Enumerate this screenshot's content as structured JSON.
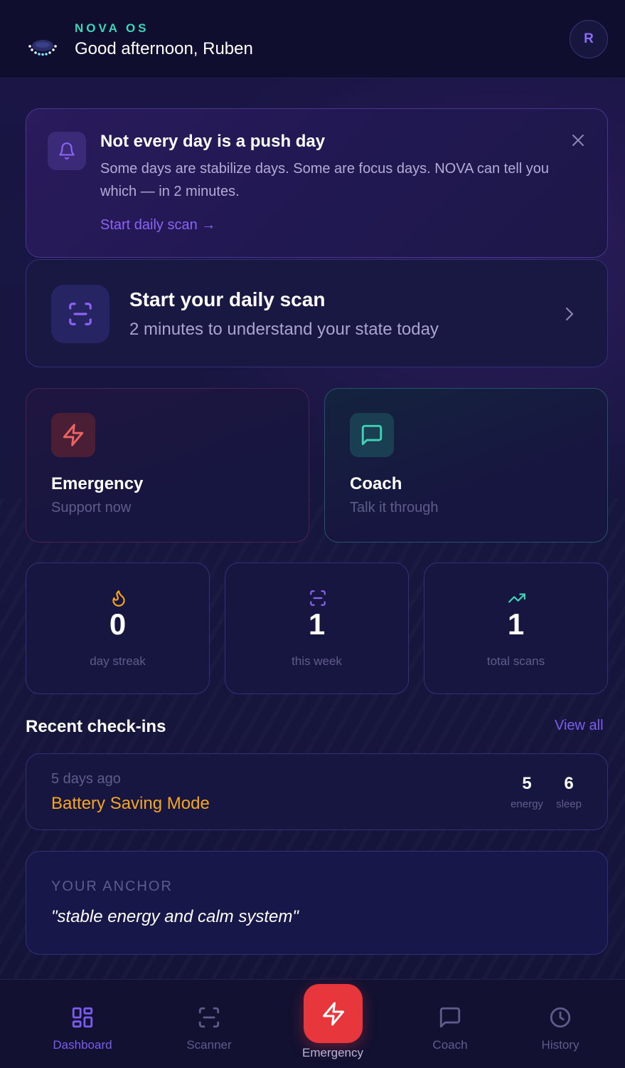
{
  "header": {
    "brand": "NOVA OS",
    "greeting": "Good afternoon, Ruben",
    "avatar_initial": "R",
    "logo_icon": "nova-orb-icon"
  },
  "notice": {
    "icon": "bell-icon",
    "title": "Not every day is a push day",
    "body": "Some days are stabilize days. Some are focus days. NOVA can tell you which — in 2 minutes.",
    "link": "Start daily scan →",
    "close_icon": "close-icon"
  },
  "scan_card": {
    "icon": "scan-icon",
    "title": "Start your daily scan",
    "subtitle": "2 minutes to understand your state today"
  },
  "actions": {
    "emergency": {
      "title": "Emergency",
      "subtitle": "Support now",
      "icon": "lightning-icon",
      "color": "#f06363"
    },
    "coach": {
      "title": "Coach",
      "subtitle": "Talk it through",
      "icon": "chat-icon",
      "color": "#3fd6b8"
    }
  },
  "stats": [
    {
      "value": "0",
      "label": "day streak",
      "icon": "flame-icon",
      "color": "#f5a623"
    },
    {
      "value": "1",
      "label": "this week",
      "icon": "scan-icon",
      "color": "#8b63f5"
    },
    {
      "value": "1",
      "label": "total scans",
      "icon": "trend-up-icon",
      "color": "#3fd6b8"
    }
  ],
  "recent": {
    "title": "Recent check-ins",
    "view_all": "View all",
    "items": [
      {
        "time": "5 days ago",
        "mode": "Battery Saving Mode",
        "energy_value": "5",
        "energy_label": "energy",
        "sleep_value": "6",
        "sleep_label": "sleep"
      }
    ]
  },
  "anchor": {
    "label": "YOUR ANCHOR",
    "text": "\"stable energy and calm system\""
  },
  "nav": {
    "dashboard": "Dashboard",
    "scanner": "Scanner",
    "emergency": "Emergency",
    "coach": "Coach",
    "history": "History",
    "active": "Dashboard"
  },
  "colors": {
    "accent": "#7c5cf0",
    "teal": "#3fd6b8",
    "danger": "#e8363d",
    "warning": "#f5a623",
    "background": "#15143d"
  }
}
